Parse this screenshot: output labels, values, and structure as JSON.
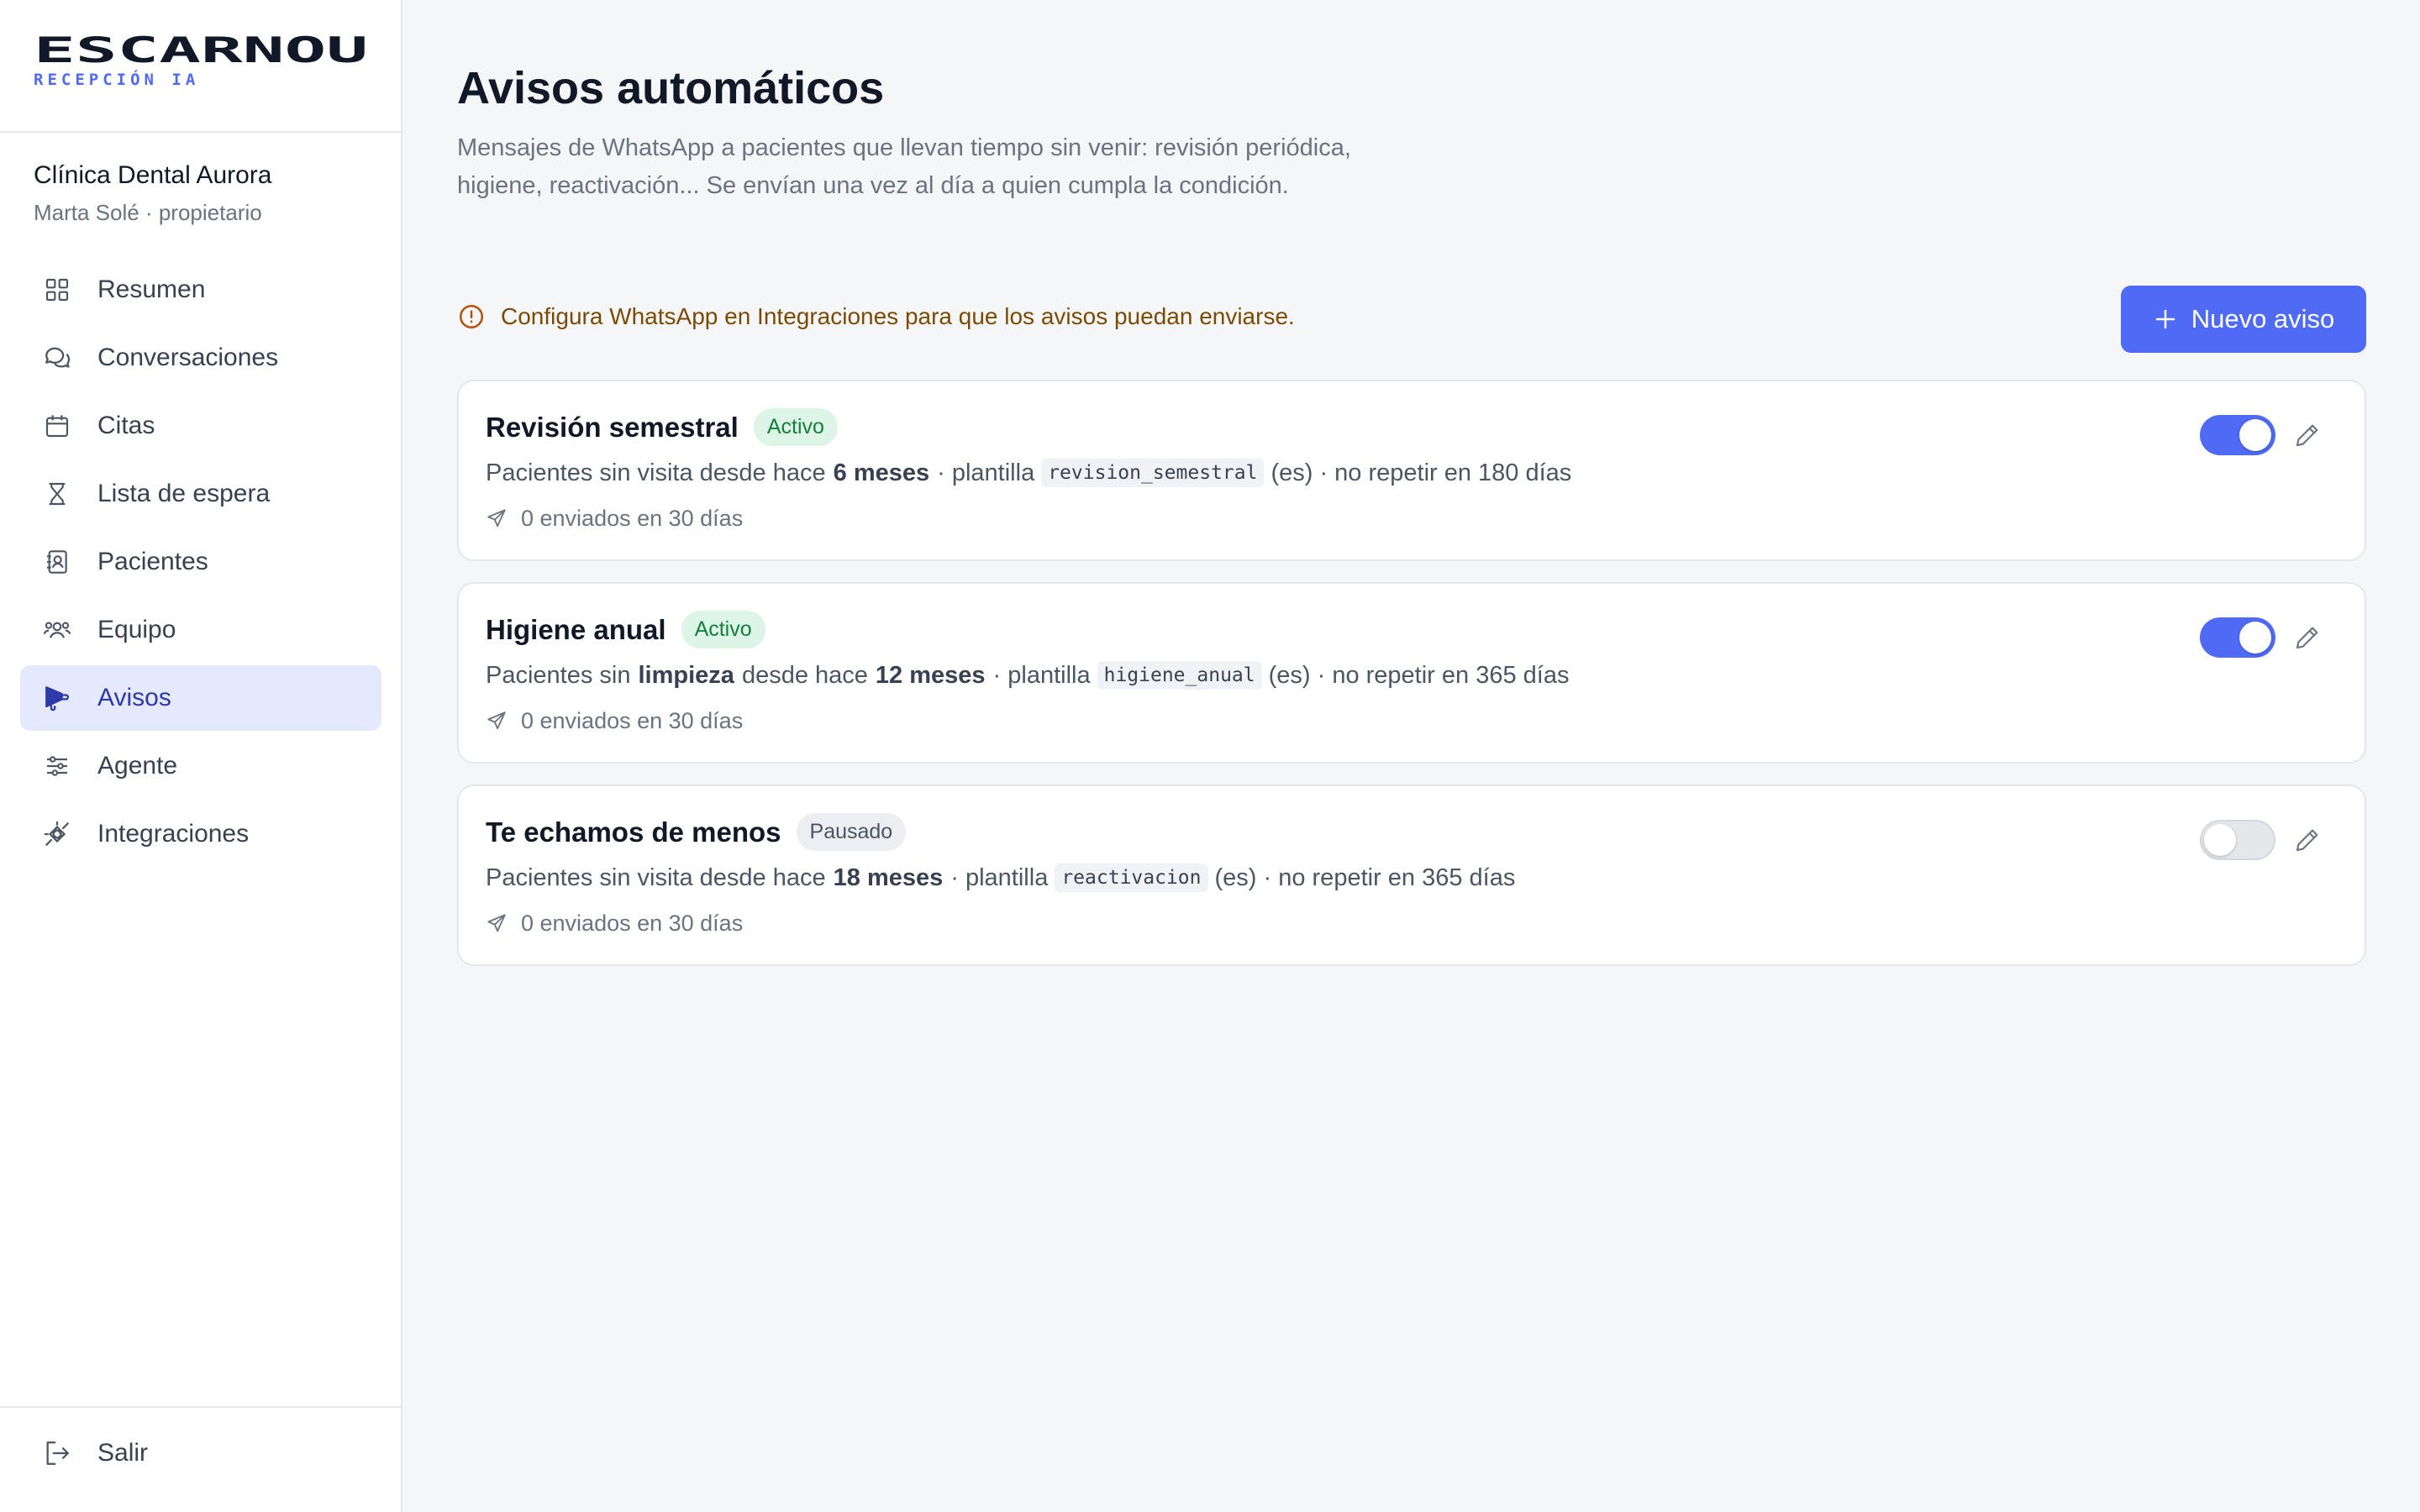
{
  "brand": {
    "name": "ESCARNOU",
    "subtitle": "RECEPCIÓN IA"
  },
  "clinic": {
    "name": "Clínica Dental Aurora",
    "user": "Marta Solé · propietario"
  },
  "nav": [
    {
      "label": "Resumen",
      "icon": "grid-icon"
    },
    {
      "label": "Conversaciones",
      "icon": "chat-bubbles-icon"
    },
    {
      "label": "Citas",
      "icon": "calendar-icon"
    },
    {
      "label": "Lista de espera",
      "icon": "hourglass-icon"
    },
    {
      "label": "Pacientes",
      "icon": "contact-book-icon"
    },
    {
      "label": "Equipo",
      "icon": "team-icon"
    },
    {
      "label": "Avisos",
      "icon": "megaphone-icon",
      "active": true
    },
    {
      "label": "Agente",
      "icon": "sliders-icon"
    },
    {
      "label": "Integraciones",
      "icon": "plug-icon"
    }
  ],
  "footer": {
    "logout_label": "Salir"
  },
  "page": {
    "title": "Avisos automáticos",
    "description": "Mensajes de WhatsApp a pacientes que llevan tiempo sin venir: revisión periódica, higiene, reactivación... Se envían una vez al día a quien cumpla la condición."
  },
  "warning": {
    "text": "Configura WhatsApp en Integraciones para que los avisos puedan enviarse."
  },
  "new_button": {
    "label": "Nuevo aviso"
  },
  "avisos": [
    {
      "title": "Revisión semestral",
      "status": "Activo",
      "enabled": true,
      "desc_prefix": "Pacientes sin visita desde hace",
      "desc_bold_word": "",
      "desc_mid": "",
      "period": "6 meses",
      "plantilla_label": "· plantilla",
      "template": "revision_semestral",
      "suffix": "(es) · no repetir en 180 días",
      "stats": "0 enviados en 30 días"
    },
    {
      "title": "Higiene anual",
      "status": "Activo",
      "enabled": true,
      "desc_prefix": "Pacientes sin",
      "desc_bold_word": "limpieza",
      "desc_mid": "desde hace",
      "period": "12 meses",
      "plantilla_label": "· plantilla",
      "template": "higiene_anual",
      "suffix": "(es) · no repetir en 365 días",
      "stats": "0 enviados en 30 días"
    },
    {
      "title": "Te echamos de menos",
      "status": "Pausado",
      "enabled": false,
      "desc_prefix": "Pacientes sin visita desde hace",
      "desc_bold_word": "",
      "desc_mid": "",
      "period": "18 meses",
      "plantilla_label": "· plantilla",
      "template": "reactivacion",
      "suffix": "(es) · no repetir en 365 días",
      "stats": "0 enviados en 30 días"
    }
  ],
  "colors": {
    "accent": "#4f6bf6",
    "active_badge": "#15803d",
    "warning": "#7c4a03"
  }
}
